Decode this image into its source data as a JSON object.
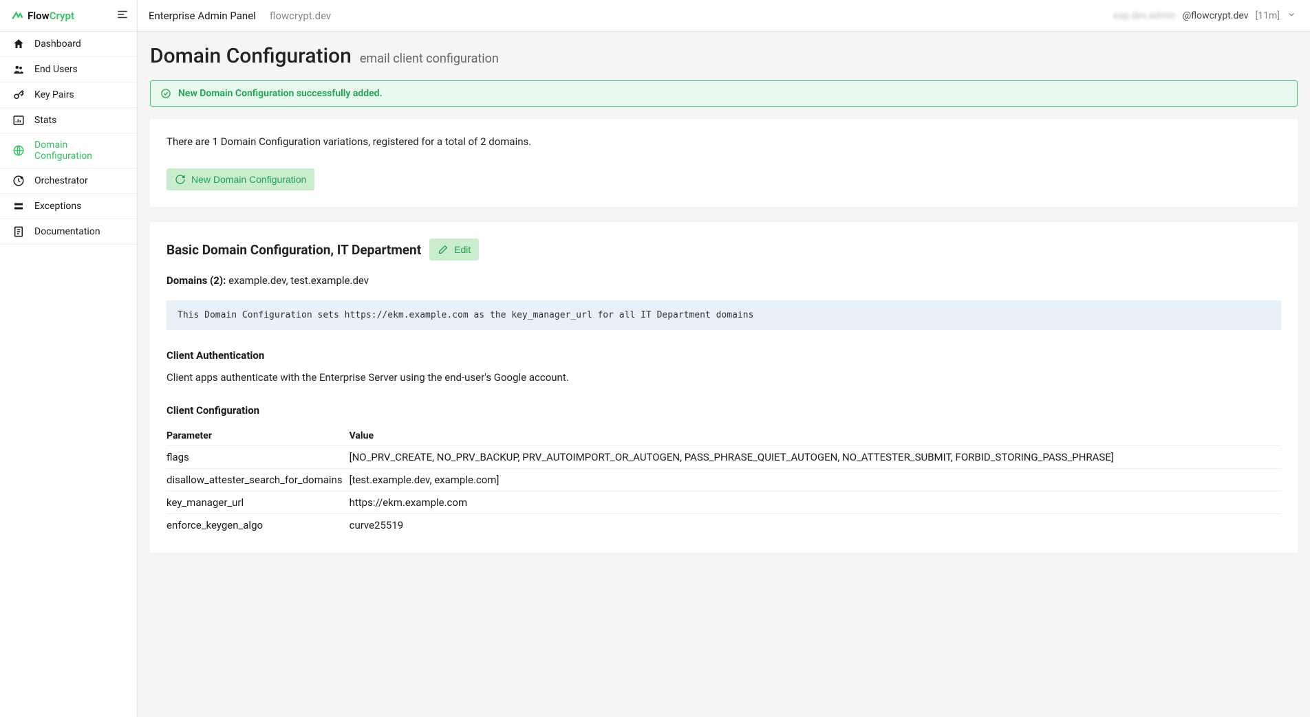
{
  "brand": {
    "part1": "Flow",
    "part2": "Crypt"
  },
  "header": {
    "panel_title": "Enterprise Admin Panel",
    "panel_domain": "flowcrypt.dev",
    "user_blur": "eap.dev.admin",
    "user_suffix": "@flowcrypt.dev",
    "user_time": "[11m]"
  },
  "sidebar": {
    "items": [
      {
        "label": "Dashboard",
        "icon": "home-icon"
      },
      {
        "label": "End Users",
        "icon": "users-icon"
      },
      {
        "label": "Key Pairs",
        "icon": "key-icon"
      },
      {
        "label": "Stats",
        "icon": "stats-icon"
      },
      {
        "label": "Domain Configuration",
        "icon": "globe-icon"
      },
      {
        "label": "Orchestrator",
        "icon": "orchestrator-icon"
      },
      {
        "label": "Exceptions",
        "icon": "exceptions-icon"
      },
      {
        "label": "Documentation",
        "icon": "doc-icon"
      }
    ],
    "active_index": 4
  },
  "page": {
    "title": "Domain Configuration",
    "subtitle": "email client configuration"
  },
  "alert": {
    "message": "New Domain Configuration successfully added."
  },
  "summary": {
    "text": "There are 1 Domain Configuration variations, registered for a total of 2 domains.",
    "new_btn": "New Domain Configuration"
  },
  "config": {
    "title": "Basic Domain Configuration, IT Department",
    "edit_btn": "Edit",
    "domains_label": "Domains (2):",
    "domains_value": "example.dev, test.example.dev",
    "description": "This Domain Configuration sets https://ekm.example.com as the key_manager_url for all IT Department domains",
    "client_auth_heading": "Client Authentication",
    "client_auth_text": "Client apps authenticate with the Enterprise Server using the end-user's Google account.",
    "client_conf_heading": "Client Configuration",
    "table": {
      "col_param": "Parameter",
      "col_value": "Value",
      "rows": [
        {
          "param": "flags",
          "value": "[NO_PRV_CREATE, NO_PRV_BACKUP, PRV_AUTOIMPORT_OR_AUTOGEN, PASS_PHRASE_QUIET_AUTOGEN, NO_ATTESTER_SUBMIT, FORBID_STORING_PASS_PHRASE]"
        },
        {
          "param": "disallow_attester_search_for_domains",
          "value": "[test.example.dev, example.com]"
        },
        {
          "param": "key_manager_url",
          "value": "https://ekm.example.com"
        },
        {
          "param": "enforce_keygen_algo",
          "value": "curve25519"
        }
      ]
    }
  }
}
